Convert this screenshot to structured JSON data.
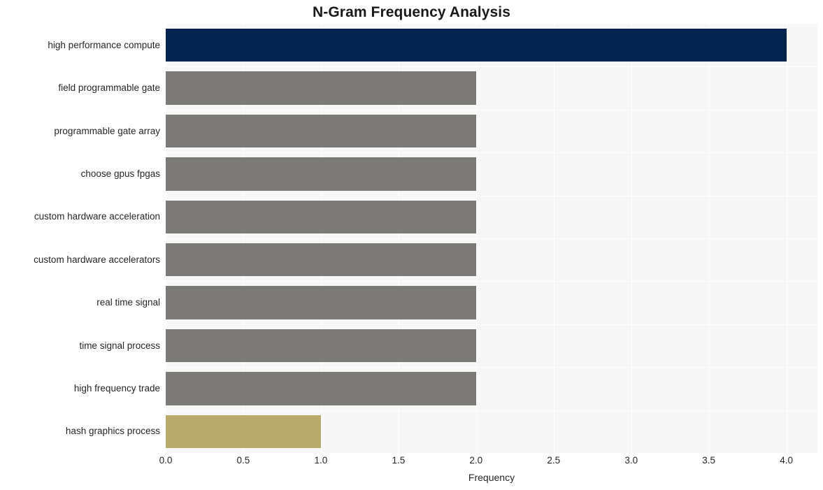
{
  "chart_data": {
    "type": "bar",
    "orientation": "horizontal",
    "title": "N-Gram Frequency Analysis",
    "xlabel": "Frequency",
    "ylabel": "",
    "categories": [
      "high performance compute",
      "field programmable gate",
      "programmable gate array",
      "choose gpus fpgas",
      "custom hardware acceleration",
      "custom hardware accelerators",
      "real time signal",
      "time signal process",
      "high frequency trade",
      "hash graphics process"
    ],
    "values": [
      4,
      2,
      2,
      2,
      2,
      2,
      2,
      2,
      2,
      1
    ],
    "bar_colors": [
      "#04244f",
      "#7b7a77",
      "#7b7a77",
      "#7b7a77",
      "#7b7a77",
      "#7b7a77",
      "#7b7a77",
      "#7b7a77",
      "#7b7a77",
      "#b8ab6b"
    ],
    "xlim": [
      0,
      4.2
    ],
    "xticks": [
      0,
      0.5,
      1,
      1.5,
      2,
      2.5,
      3,
      3.5,
      4
    ],
    "xtick_labels": [
      "0.0",
      "0.5",
      "1.0",
      "1.5",
      "2.0",
      "2.5",
      "3.0",
      "3.5",
      "4.0"
    ],
    "grid": true,
    "grid_color": "#ffffff",
    "plot_background": "#f7f7f7",
    "figure_background": "#ffffff",
    "legend": null
  },
  "style": {
    "title_color": "#1a1a1a",
    "tick_label_color": "#262626",
    "axis_label_color": "#262626"
  }
}
